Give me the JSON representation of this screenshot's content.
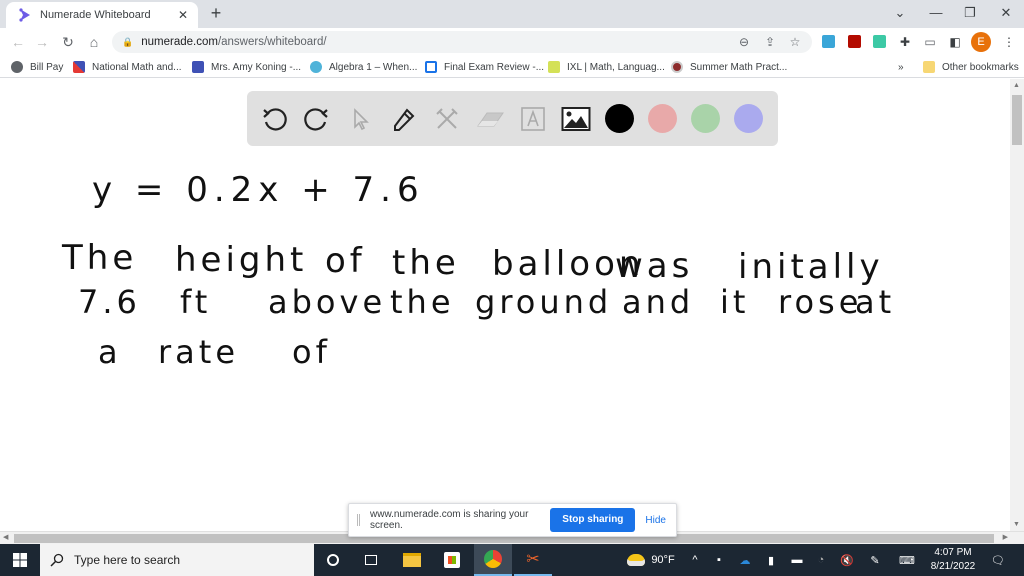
{
  "browser": {
    "tab_title": "Numerade Whiteboard",
    "tab_close": "✕",
    "new_tab": "+",
    "window_controls": {
      "tab_search": "⌄",
      "minimize": "—",
      "restore": "❐",
      "close": "✕"
    },
    "nav": {
      "back": "←",
      "forward": "→",
      "reload": "↻",
      "home": "⌂"
    },
    "address": {
      "host": "numerade.com",
      "path": "/answers/whiteboard/"
    },
    "profile_initial": "E",
    "colors": {
      "profile": "#e8710a",
      "accent": "#1a73e8"
    }
  },
  "bookmarks": {
    "items": [
      {
        "label": "Bill Pay",
        "icon": "globe-icon"
      },
      {
        "label": "National Math and...",
        "icon": "x-logo-icon"
      },
      {
        "label": "Mrs. Amy Koning -...",
        "icon": "calendar-icon"
      },
      {
        "label": "Algebra 1 – When...",
        "icon": "wordpress-icon"
      },
      {
        "label": "Final Exam Review -...",
        "icon": "layout-icon"
      },
      {
        "label": "IXL | Math, Languag...",
        "icon": "ixl-icon"
      },
      {
        "label": "Summer Math Pract...",
        "icon": "site-icon"
      }
    ],
    "overflow": "»",
    "other": "Other bookmarks"
  },
  "whiteboard": {
    "tools": [
      {
        "name": "undo",
        "enabled": true
      },
      {
        "name": "redo",
        "enabled": true
      },
      {
        "name": "select",
        "enabled": false
      },
      {
        "name": "pen",
        "enabled": true
      },
      {
        "name": "tools",
        "enabled": false
      },
      {
        "name": "eraser",
        "enabled": false
      },
      {
        "name": "text",
        "enabled": false
      },
      {
        "name": "image",
        "enabled": true
      }
    ],
    "colors": [
      "#000000",
      "#e8a9a9",
      "#a9d3a9",
      "#aaaaee"
    ],
    "selected_color": "#000000",
    "handwriting": {
      "equation": "y = 0.2x + 7.6",
      "lines": [
        [
          "The",
          "height",
          "of",
          "the",
          "balloon",
          "was",
          "initally"
        ],
        [
          "7.6",
          "ft",
          "above",
          "the",
          "ground",
          "and",
          "it",
          "rose",
          "at"
        ],
        [
          "a",
          "rate",
          "of"
        ]
      ]
    }
  },
  "sharing_bar": {
    "message": "www.numerade.com is sharing your screen.",
    "stop_label": "Stop sharing",
    "hide_label": "Hide"
  },
  "taskbar": {
    "search_placeholder": "Type here to search",
    "weather": "90°F",
    "time": "4:07 PM",
    "date": "8/21/2022"
  }
}
